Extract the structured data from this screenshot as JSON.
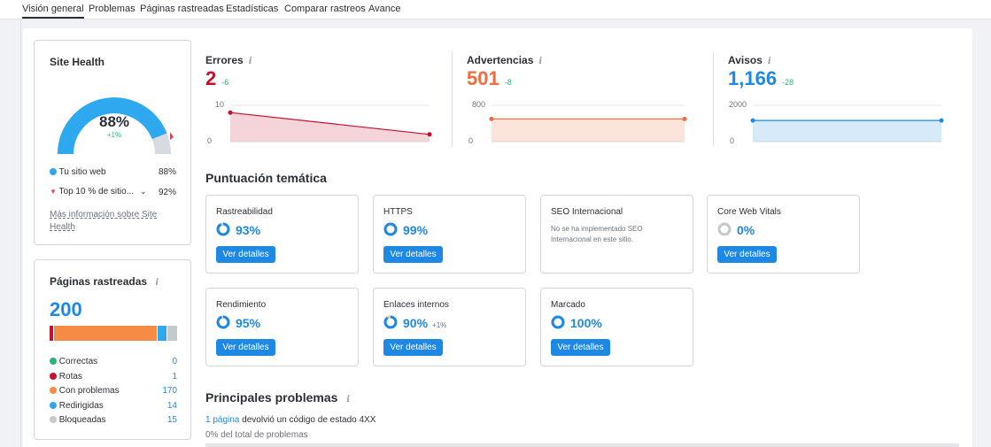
{
  "tabs": [
    "Visión general",
    "Problemas",
    "Páginas rastreadas",
    "Estadísticas",
    "Comparar rastreos",
    "Avance"
  ],
  "site_health": {
    "title": "Site Health",
    "percent": "88%",
    "delta": "+1%",
    "gauge_fraction": 0.88,
    "legend": [
      {
        "label": "Tu sitio web",
        "value": "88%"
      },
      {
        "label": "Top 10 % de sitio...",
        "value": "92%"
      }
    ],
    "more_link": "Más información sobre Site Health"
  },
  "crawled": {
    "title": "Páginas rastreadas",
    "total": "200",
    "items": [
      {
        "label": "Correctas",
        "value": "0",
        "color": "#2ab37a"
      },
      {
        "label": "Rotas",
        "value": "1",
        "color": "#c8102e"
      },
      {
        "label": "Con problemas",
        "value": "170",
        "color": "#f58b45"
      },
      {
        "label": "Redirigidas",
        "value": "14",
        "color": "#2ea9f0"
      },
      {
        "label": "Bloqueadas",
        "value": "15",
        "color": "#c4c8cf"
      }
    ]
  },
  "metrics": [
    {
      "title": "Errores",
      "value": "2",
      "delta": "-6",
      "ytop": "10",
      "ybottom": "0",
      "color": "#c8102e"
    },
    {
      "title": "Advertencias",
      "value": "501",
      "delta": "-8",
      "ytop": "800",
      "ybottom": "0",
      "color": "#f26b3a"
    },
    {
      "title": "Avisos",
      "value": "1,166",
      "delta": "-28",
      "ytop": "2000",
      "ybottom": "0",
      "color": "#1e88e5"
    }
  ],
  "thematic": {
    "title": "Puntuación temática",
    "button_label": "Ver detalles",
    "cards": [
      {
        "name": "Rastreabilidad",
        "score": "93%"
      },
      {
        "name": "HTTPS",
        "score": "99%"
      },
      {
        "name": "SEO Internacional",
        "note": "No se ha implementado SEO Internacional en este sitio."
      },
      {
        "name": "Core Web Vitals",
        "score": "0%"
      },
      {
        "name": "Rendimiento",
        "score": "95%"
      },
      {
        "name": "Enlaces internos",
        "score": "90%",
        "delta": "+1%"
      },
      {
        "name": "Marcado",
        "score": "100%"
      }
    ]
  },
  "top_issues": {
    "title": "Principales problemas",
    "link": "1 página",
    "text": "devolvió un código de estado 4XX",
    "sub": "0% del total de problemas"
  }
}
